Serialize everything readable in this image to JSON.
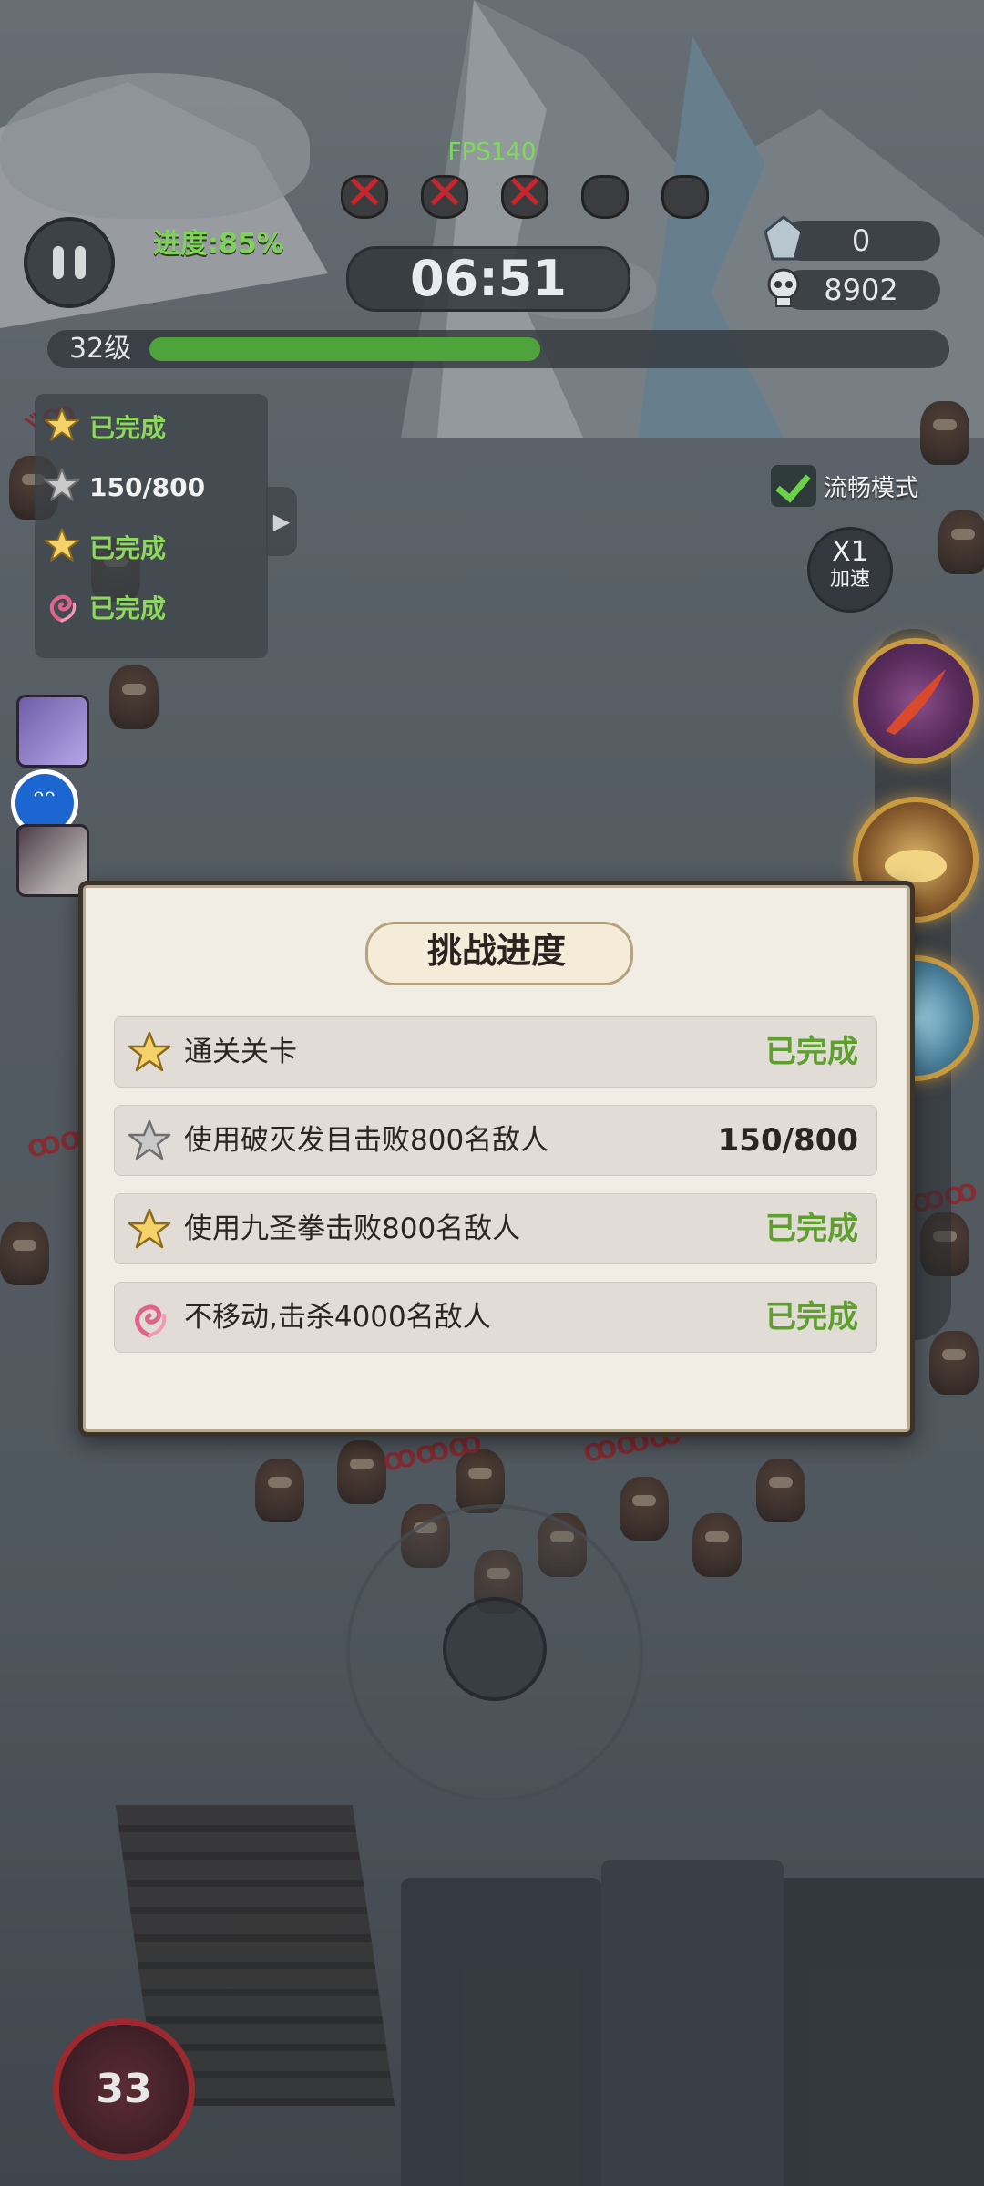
{
  "hud": {
    "fps": "FPS140",
    "progress": "进度:85%",
    "timer": "06:51",
    "gems": "0",
    "skulls": "8902",
    "level": "32级",
    "level_progress": 0.5
  },
  "mini_quests": [
    {
      "icon": "star-gold-icon",
      "text": "已完成",
      "done": true
    },
    {
      "icon": "star-gray-icon",
      "text": "150/800",
      "done": false
    },
    {
      "icon": "star-gold-icon",
      "text": "已完成",
      "done": true
    },
    {
      "icon": "spiral-icon",
      "text": "已完成",
      "done": true
    }
  ],
  "settings": {
    "smooth_mode": "流畅模式",
    "speed_value": "X1",
    "speed_label": "加速"
  },
  "dialog": {
    "title": "挑战进度",
    "tasks": [
      {
        "icon": "star-gold-icon",
        "name": "通关关卡",
        "status": "已完成"
      },
      {
        "icon": "star-gray-icon",
        "name": "使用破灭发目击败800名敌人",
        "status": "150/800"
      },
      {
        "icon": "star-gold-icon",
        "name": "使用九圣拳击败800名敌人",
        "status": "已完成"
      },
      {
        "icon": "spiral-icon",
        "name": "不移动,击杀4000名敌人",
        "status": "已完成"
      }
    ]
  },
  "player_level": "33",
  "colors": {
    "done_green": "#5f9f2f",
    "fps_green": "#7bdc5a",
    "level_fill": "#4ea33a",
    "boss_x_red": "#c8262d"
  }
}
